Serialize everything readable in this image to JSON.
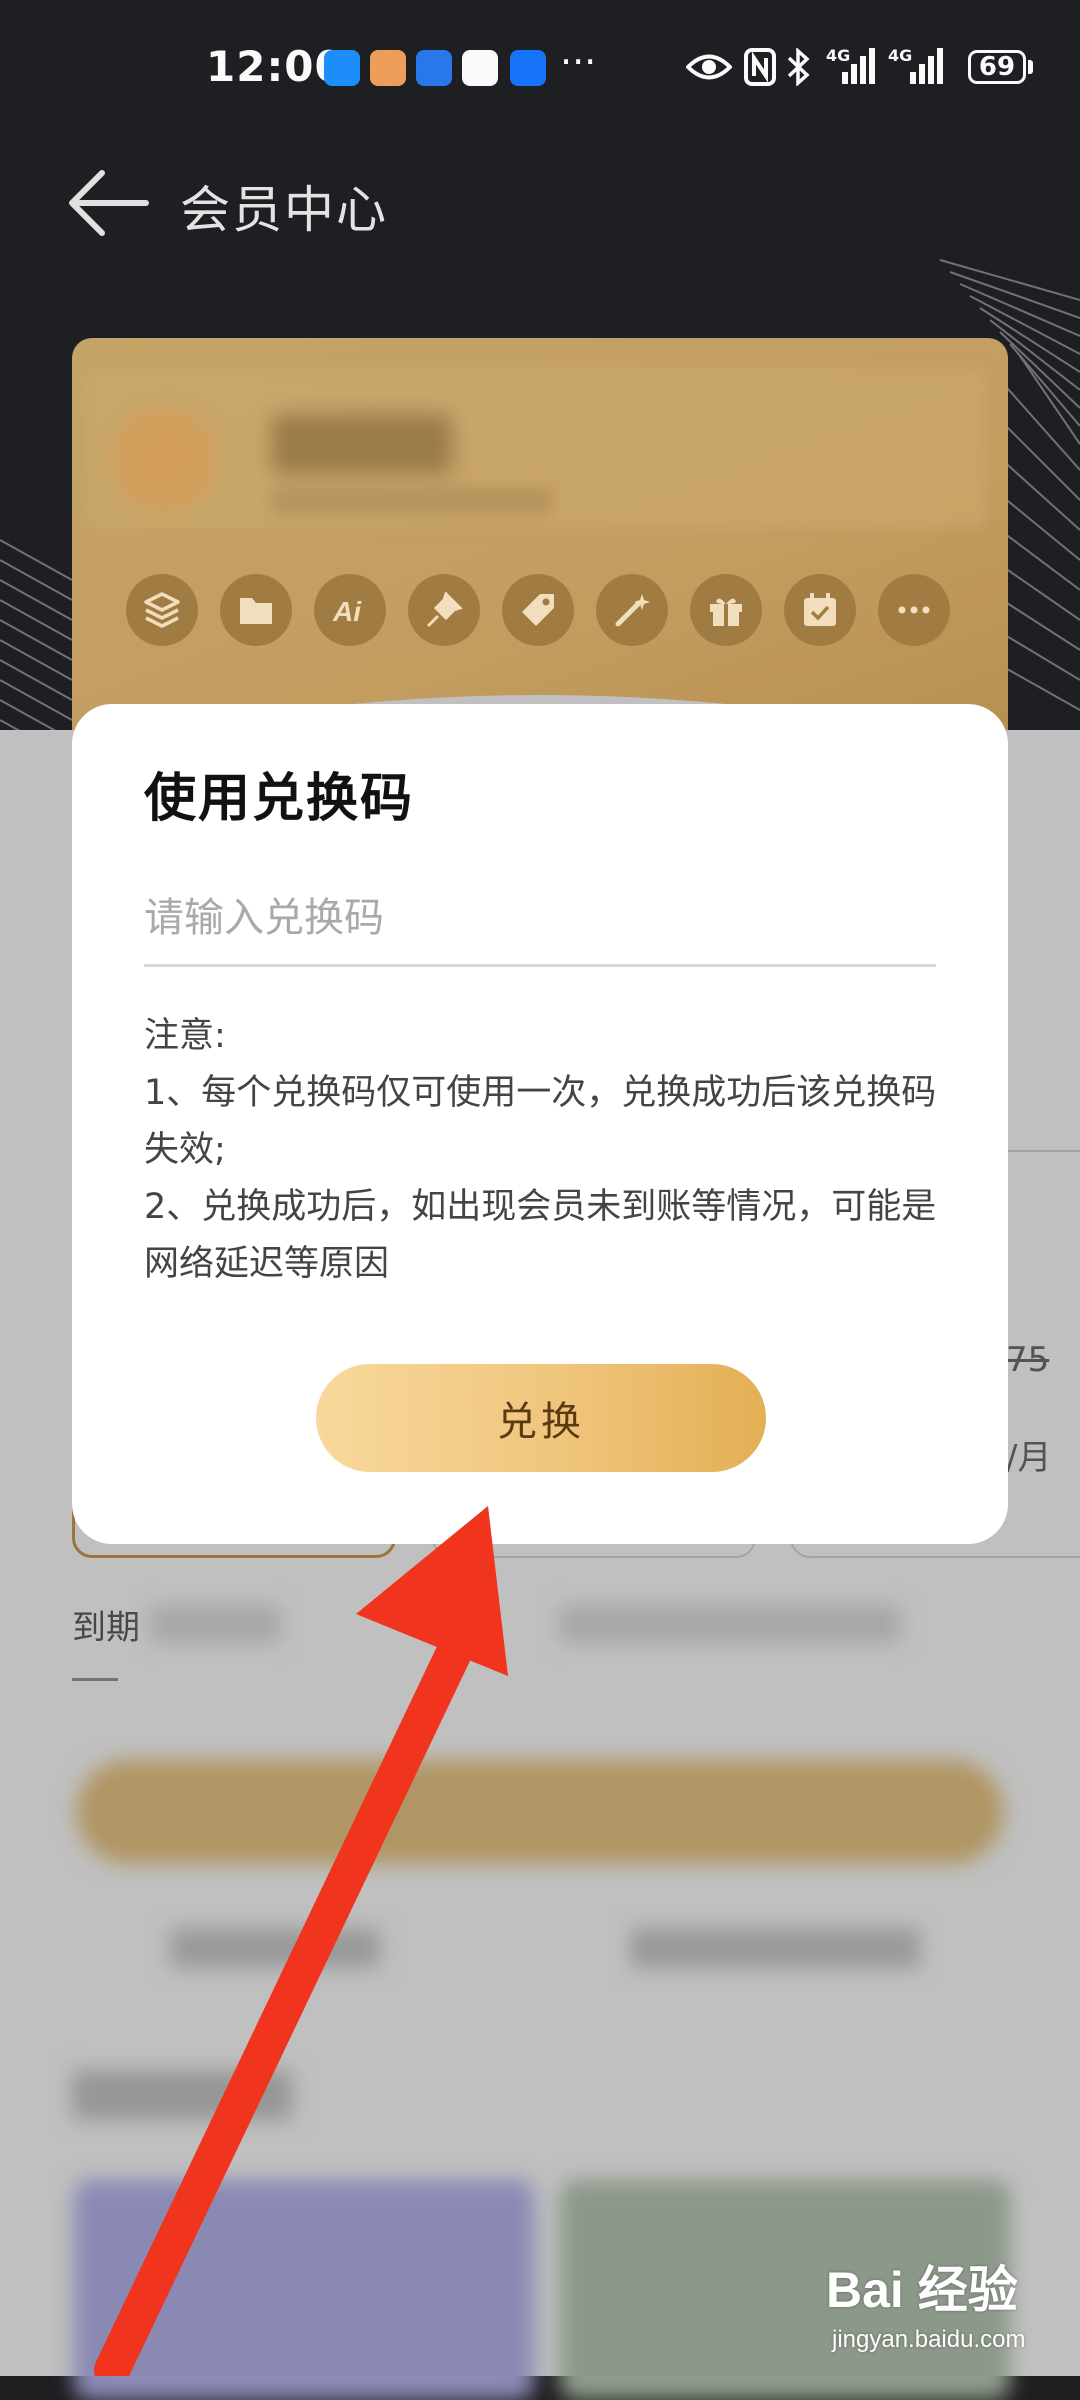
{
  "status_bar": {
    "time": "12:00",
    "more": "···",
    "network_1": "4G",
    "network_2": "4G",
    "battery": "69"
  },
  "header": {
    "title": "会员中心"
  },
  "member_card": {
    "perk_icons": [
      "layers-icon",
      "folder-icon",
      "ai-icon",
      "pin-icon",
      "tag-icon",
      "magic-wand-icon",
      "gift-icon",
      "calendar-check-icon",
      "more-icon"
    ]
  },
  "background_page": {
    "price_old": "75",
    "price_unit": "/月",
    "expire_label": "到期"
  },
  "dialog": {
    "title": "使用兑换码",
    "input_placeholder": "请输入兑换码",
    "input_value": "",
    "notice_heading": "注意:",
    "notice_1": "1、每个兑换码仅可使用一次，兑换成功后该兑换码失效;",
    "notice_2": "2、兑换成功后，如出现会员未到账等情况，可能是网络延迟等原因",
    "button_label": "兑换"
  },
  "watermark": {
    "logo": "Bai 经验",
    "url": "jingyan.baidu.com"
  },
  "colors": {
    "header_bg": "#1f2024",
    "card_gold": "#c9a86a",
    "button_gold": "#efc57c",
    "arrow_red": "#f0341e"
  }
}
